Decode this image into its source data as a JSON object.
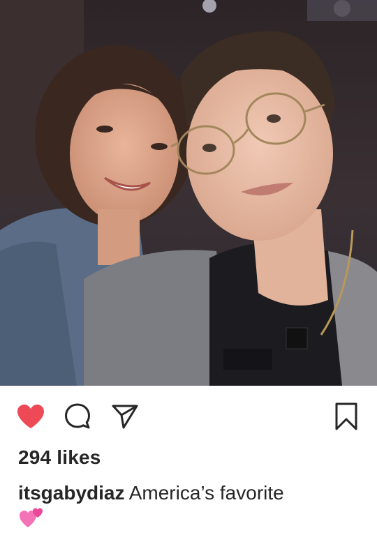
{
  "post": {
    "likes_text": "294 likes",
    "username": "itsgabydiaz",
    "caption_text": "America’s favorite",
    "caption_emoji": "two-hearts-emoji",
    "liked": true
  },
  "icons": {
    "like": "heart-icon",
    "comment": "comment-bubble-icon",
    "share": "paper-plane-icon",
    "save": "bookmark-icon"
  },
  "colors": {
    "liked_heart": "#ed4956",
    "text": "#262626",
    "emoji_pink": "#f472b6"
  }
}
